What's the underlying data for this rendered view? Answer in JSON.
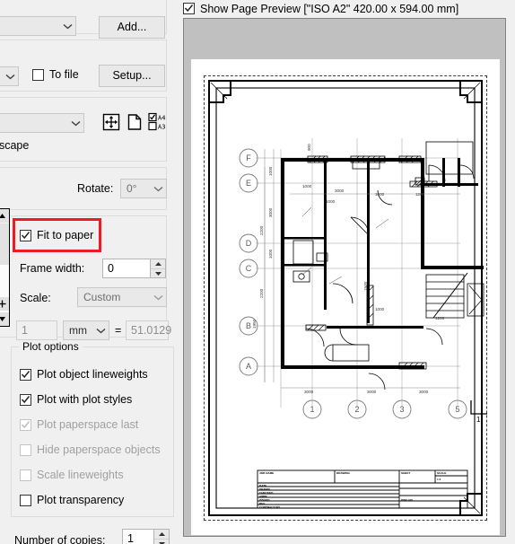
{
  "left_panel": {
    "printer_group": {
      "combo_value": "",
      "add_button": "Add..."
    },
    "output_group": {
      "combo_value": "",
      "to_file_label": "To file",
      "to_file_checked": false,
      "setup_button": "Setup..."
    },
    "paper_group": {
      "combo_value": "",
      "icons": [
        "center-plot-icon",
        "page-icon",
        "paper-size-a4-a3-icon"
      ],
      "paper_size_options": [
        "A4",
        "A3"
      ],
      "a4_checked": true,
      "a3_checked": false
    },
    "orientation_group": {
      "orientation_value": "dscape",
      "rotate_label": "Rotate:",
      "rotate_value": "0°"
    },
    "scale_group": {
      "fit_to_paper_label": "Fit to paper",
      "fit_to_paper_checked": true,
      "frame_width_label": "Frame width:",
      "frame_width_value": "0",
      "scale_label": "Scale:",
      "scale_value": "Custom",
      "scale_numerator": "1",
      "scale_unit": "mm",
      "equals": "=",
      "scale_denominator": "51.0129"
    },
    "plot_options": {
      "legend": "Plot options",
      "items": [
        {
          "label": "Plot object lineweights",
          "checked": true,
          "disabled": false
        },
        {
          "label": "Plot with plot styles",
          "checked": true,
          "disabled": false
        },
        {
          "label": "Plot paperspace last",
          "checked": true,
          "disabled": true
        },
        {
          "label": "Hide paperspace objects",
          "checked": false,
          "disabled": true
        },
        {
          "label": "Scale lineweights",
          "checked": false,
          "disabled": true
        },
        {
          "label": "Plot transparency",
          "checked": false,
          "disabled": false
        }
      ]
    },
    "copies": {
      "label": "Number of copies:",
      "value": "1"
    }
  },
  "preview": {
    "show_page_preview_label": "Show Page Preview [\"ISO A2\" 420.00 x 594.00 mm]",
    "show_page_preview_checked": true,
    "paper_name": "ISO A2",
    "paper_width_mm": "420.00",
    "paper_height_mm": "594.00"
  },
  "drawing": {
    "grid_labels_vertical": [
      "F",
      "E",
      "D",
      "C",
      "B",
      "A"
    ],
    "grid_labels_horizontal": [
      "1",
      "2",
      "3",
      "5"
    ],
    "detail_marker": "1",
    "dimension_texts": [
      "1000",
      "3000",
      "1000",
      "2200",
      "2200",
      "1950",
      "1250",
      "1500",
      "900"
    ],
    "room_dimensions": [
      "3000",
      "1000",
      "1200",
      "1000"
    ],
    "bottom_dimensions": [
      "3000",
      "3000",
      "3000"
    ],
    "titleblock_rows": [
      {
        "left": "JOB NAME",
        "mid": "DRAWING",
        "right": "SHEET",
        "far": "SCALE",
        "far2": "1:1"
      },
      {
        "left": "DATE"
      },
      {
        "left": "DRAWN"
      },
      {
        "left": "CHECKED"
      },
      {
        "left": "APPR."
      },
      {
        "left": "ISSUED"
      },
      {
        "left": "REV",
        "mid2": "DWG NO"
      },
      {
        "left": "CONTRACT NO"
      }
    ]
  },
  "colors": {
    "highlight": "#ed1c24",
    "panel_bg": "#f0f0f0",
    "preview_bg": "#c0c0c0",
    "paper": "#ffffff",
    "disabled_text": "#a0a0a0"
  }
}
